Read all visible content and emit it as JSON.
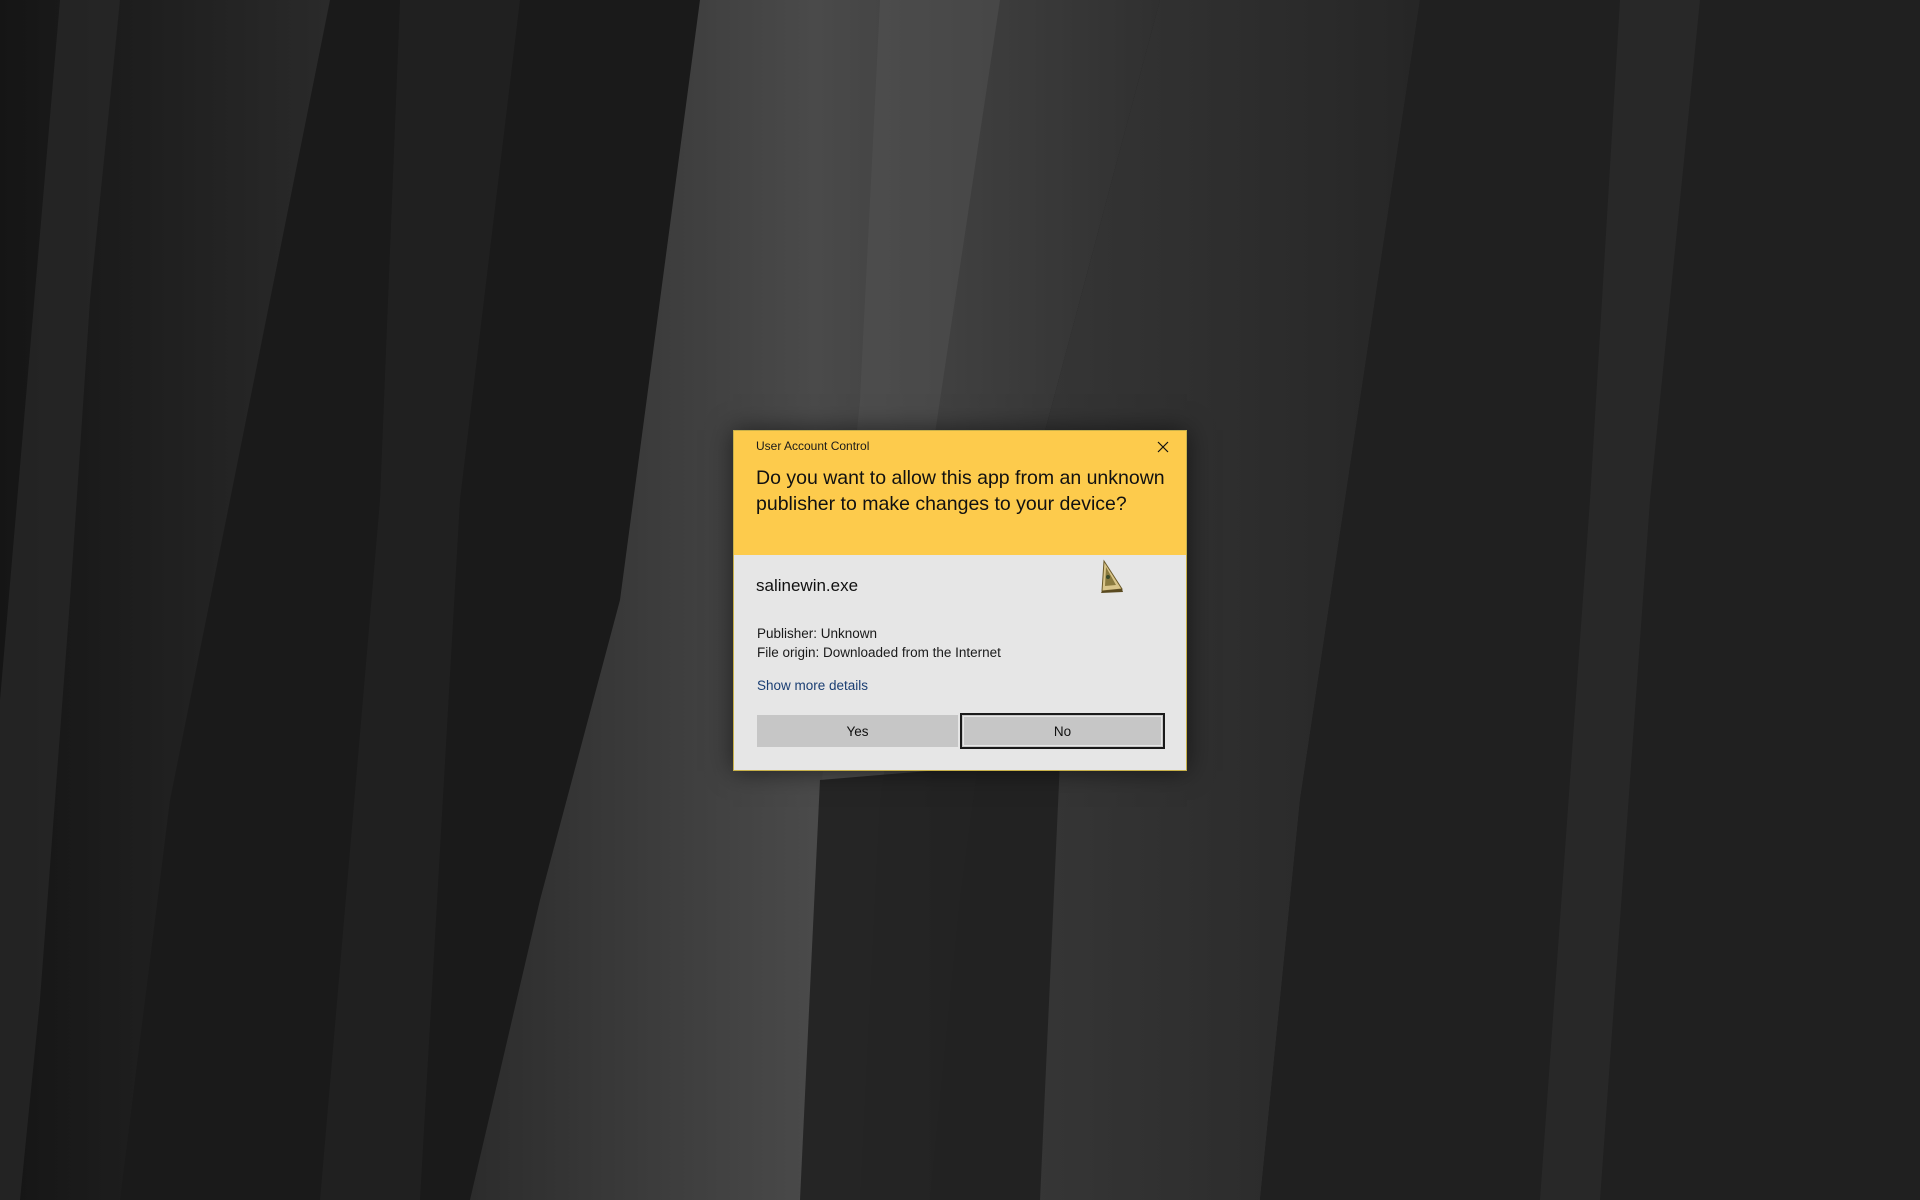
{
  "dialog": {
    "title": "User Account Control",
    "question": "Do you want to allow this app from an unknown publisher to make changes to your device?",
    "program_name": "salinewin.exe",
    "publisher_line": "Publisher: Unknown",
    "origin_line": "File origin: Downloaded from the Internet",
    "show_more_label": "Show more details",
    "yes_label": "Yes",
    "no_label": "No",
    "close_icon": "close-icon",
    "app_icon": "salinewin-app-icon"
  },
  "colors": {
    "header_background": "#fdcb4c",
    "body_background": "#e6e6e6",
    "button_background": "#c6c6c6",
    "link_color": "#1a3e73",
    "desktop_background": "#1c1c1c"
  }
}
